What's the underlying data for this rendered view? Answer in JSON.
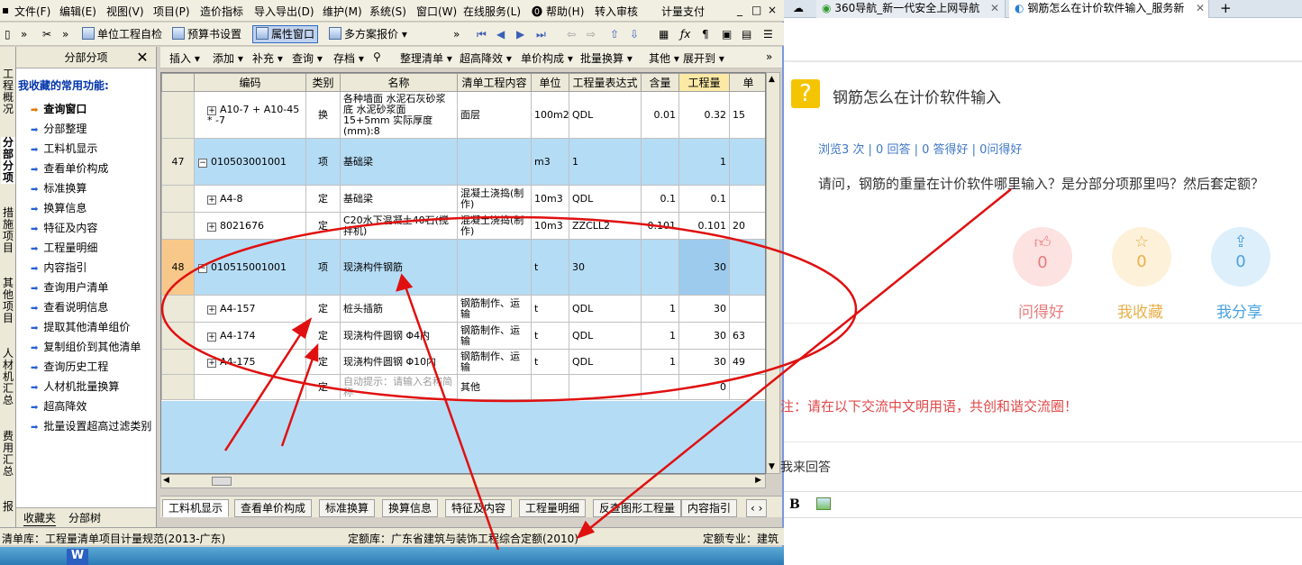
{
  "app": {
    "menu": [
      "文件(F)",
      "编辑(E)",
      "视图(V)",
      "项目(P)",
      "造价指标",
      "导入导出(D)",
      "维护(M)",
      "系统(S)",
      "窗口(W)",
      "在线服务(L)",
      "帮助(H)",
      "转入审核",
      "计量支付"
    ],
    "window_controls": [
      "_",
      "□",
      "×"
    ],
    "toolbar1": {
      "unit_check": "单位工程自检",
      "budget_setting": "预算书设置",
      "property_window": "属性窗口",
      "multi_scheme": "多方案报价"
    },
    "vertical_tabs": [
      "工程概况",
      "分部分项",
      "措施项目",
      "其他项目",
      "人材机汇总",
      "费用汇总",
      "报"
    ],
    "favorites": {
      "header": "分部分项",
      "close": "✕",
      "title": "我收藏的常用功能:",
      "items": [
        "查询窗口",
        "分部整理",
        "工料机显示",
        "查看单价构成",
        "标准换算",
        "换算信息",
        "特征及内容",
        "工程量明细",
        "内容指引",
        "查询用户清单",
        "查看说明信息",
        "提取其他清单组价",
        "复制组价到其他清单",
        "查询历史工程",
        "人材机批量换算",
        "超高降效",
        "批量设置超高过滤类别"
      ],
      "tabs": [
        "收藏夹",
        "分部树"
      ]
    },
    "toolbar2": [
      "插入",
      "添加",
      "补充",
      "查询",
      "存档",
      "整理清单",
      "超高降效",
      "单价构成",
      "批量换算",
      "其他",
      "展开到"
    ],
    "grid": {
      "headers": [
        "编码",
        "类别",
        "名称",
        "清单工程内容",
        "单位",
        "工程量表达式",
        "含量",
        "工程量",
        "单"
      ],
      "rows": [
        {
          "no": "",
          "code": "A10-7 + A10-45 * -7",
          "type": "换",
          "name": "各种墙面 水泥石灰砂浆底 水泥砂浆面 15+5mm 实际厚度(mm):8",
          "content": "面层",
          "unit": "100m2",
          "expr": "QDL",
          "qty_ratio": "0.01",
          "qty": "0.32",
          "price": "15",
          "style": "white",
          "expand": "+"
        },
        {
          "no": "47",
          "code": "010503001001",
          "type": "项",
          "name": "基础梁",
          "content": "",
          "unit": "m3",
          "expr": "1",
          "qty_ratio": "",
          "qty": "1",
          "price": "",
          "style": "blue",
          "expand": "−"
        },
        {
          "no": "",
          "code": "A4-8",
          "type": "定",
          "name": "基础梁",
          "content": "混凝土浇捣(制作)",
          "unit": "10m3",
          "expr": "QDL",
          "qty_ratio": "0.1",
          "qty": "0.1",
          "price": "",
          "style": "white",
          "expand": "+"
        },
        {
          "no": "",
          "code": "8021676",
          "type": "定",
          "name": "C20水下混凝土40石(搅拌机)",
          "content": "混凝土浇捣(制作)",
          "unit": "10m3",
          "expr": "ZZCLL2",
          "qty_ratio": "0.101",
          "qty": "0.101",
          "price": "20",
          "style": "white",
          "expand": "+"
        },
        {
          "no": "48",
          "code": "010515001001",
          "type": "项",
          "name": "现浇构件钢筋",
          "content": "",
          "unit": "t",
          "expr": "30",
          "qty_ratio": "",
          "qty": "30",
          "price": "",
          "style": "blue",
          "expand": "−",
          "selected": true
        },
        {
          "no": "",
          "code": "A4-157",
          "type": "定",
          "name": "桩头插筋",
          "content": "钢筋制作、运输",
          "unit": "t",
          "expr": "QDL",
          "qty_ratio": "1",
          "qty": "30",
          "price": "",
          "style": "white",
          "expand": "+"
        },
        {
          "no": "",
          "code": "A4-174",
          "type": "定",
          "name": "现浇构件圆钢 Φ4内",
          "content": "钢筋制作、运输",
          "unit": "t",
          "expr": "QDL",
          "qty_ratio": "1",
          "qty": "30",
          "price": "63",
          "style": "white",
          "expand": "+"
        },
        {
          "no": "",
          "code": "A4-175",
          "type": "定",
          "name": "现浇构件圆钢 Φ10内",
          "content": "钢筋制作、运输",
          "unit": "t",
          "expr": "QDL",
          "qty_ratio": "1",
          "qty": "30",
          "price": "49",
          "style": "white",
          "expand": "+"
        },
        {
          "no": "",
          "code": "",
          "type": "定",
          "name": "自动提示：请输入名称简称",
          "content": "其他",
          "unit": "",
          "expr": "",
          "qty_ratio": "",
          "qty": "0",
          "price": "",
          "style": "white",
          "expand": "",
          "hint": true
        }
      ]
    },
    "bottom_tabs": [
      "工料机显示",
      "查看单价构成",
      "标准换算",
      "换算信息",
      "特征及内容",
      "工程量明细",
      "反查图形工程量",
      "内容指引"
    ],
    "status": {
      "list_lib": "清单库：工程量清单项目计量规范(2013-广东)",
      "quota_lib": "定额库：广东省建筑与装饰工程综合定额(2010)",
      "quota_major": "定额专业：建筑"
    }
  },
  "browser": {
    "tabs": [
      {
        "label": "360导航_新一代安全上网导航"
      },
      {
        "label": "钢筋怎么在计价软件输入_服务新"
      }
    ],
    "new_tab": "+",
    "question": {
      "icon": "?",
      "title": "钢筋怎么在计价软件输入",
      "stats": "浏览3 次 | 0 回答 | 0 答得好 | 0问得好",
      "body": "请问，钢筋的重量在计价软件哪里输入？是分部分项那里吗？然后套定额？"
    },
    "actions": [
      {
        "label": "问得好",
        "count": "0",
        "color": "#e87c7c",
        "bg": "#fde2e2",
        "icon": "thumb-up-icon"
      },
      {
        "label": "我收藏",
        "count": "0",
        "color": "#e8b04a",
        "bg": "#fdf1d9",
        "icon": "star-icon"
      },
      {
        "label": "我分享",
        "count": "0",
        "color": "#4aa3e0",
        "bg": "#ddeffb",
        "icon": "share-icon"
      }
    ],
    "notice": "注：请在以下交流中文明用语，共创和谐交流圈！",
    "answer_label": "我来回答",
    "editor": {
      "bold": "B"
    }
  }
}
